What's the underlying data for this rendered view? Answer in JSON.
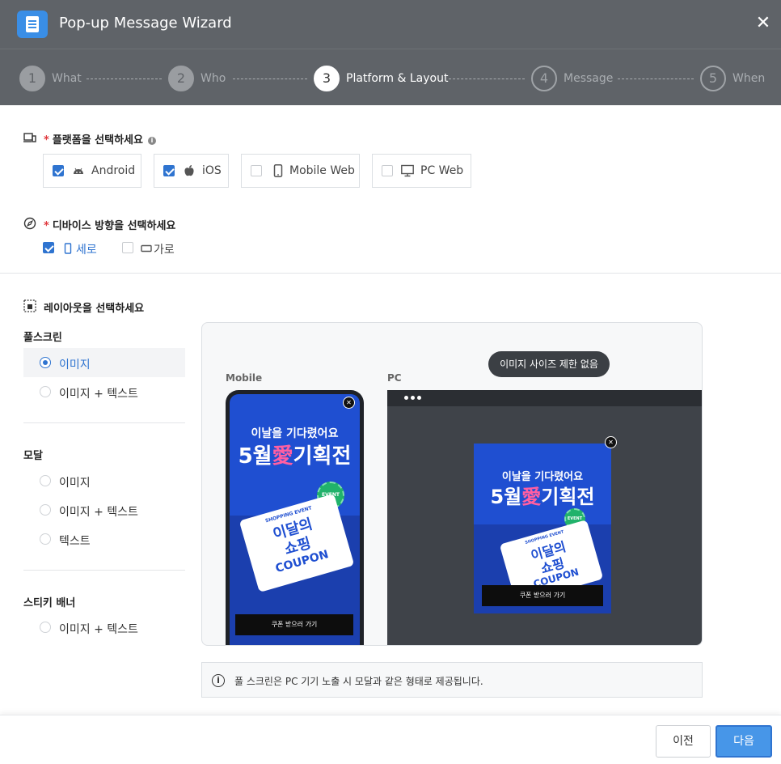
{
  "window": {
    "title": "Pop-up Message Wizard",
    "close_glyph": "✕"
  },
  "steps": [
    {
      "num": "1",
      "label": "What",
      "state": "done"
    },
    {
      "num": "2",
      "label": "Who",
      "state": "done"
    },
    {
      "num": "3",
      "label": "Platform & Layout",
      "state": "active"
    },
    {
      "num": "4",
      "label": "Message",
      "state": "pending"
    },
    {
      "num": "5",
      "label": "When",
      "state": "pending"
    }
  ],
  "platform": {
    "required_mark": "*",
    "title": "플랫폼을 선택하세요",
    "info_glyph": "i",
    "options": [
      {
        "label": "Android",
        "icon": "android-icon",
        "checked": true
      },
      {
        "label": "iOS",
        "icon": "apple-icon",
        "checked": true
      },
      {
        "label": "Mobile Web",
        "icon": "mobile-icon",
        "checked": false
      },
      {
        "label": "PC Web",
        "icon": "monitor-icon",
        "checked": false
      }
    ]
  },
  "orientation": {
    "required_mark": "*",
    "title": "디바이스 방향을 선택하세요",
    "options": [
      {
        "label": "세로",
        "icon": "portrait-icon",
        "checked": true
      },
      {
        "label": "가로",
        "icon": "landscape-icon",
        "checked": false
      }
    ]
  },
  "layout": {
    "title": "레이아웃을 선택하세요",
    "groups": [
      {
        "name": "풀스크린",
        "options": [
          {
            "label": "이미지",
            "selected": true
          },
          {
            "label": "이미지 + 텍스트",
            "selected": false
          }
        ]
      },
      {
        "name": "모달",
        "options": [
          {
            "label": "이미지",
            "selected": false
          },
          {
            "label": "이미지 + 텍스트",
            "selected": false
          },
          {
            "label": "텍스트",
            "selected": false
          }
        ]
      },
      {
        "name": "스티키 배너",
        "options": [
          {
            "label": "이미지 + 텍스트",
            "selected": false
          }
        ]
      }
    ]
  },
  "preview": {
    "mobile_label": "Mobile",
    "pc_label": "PC",
    "size_pill": "이미지 사이즈 제한 없음",
    "banner": {
      "subtitle": "이날을 기다렸어요",
      "main_a": "5월",
      "main_b": "愛",
      "main_c": "기획전",
      "ticket_small": "SHOPPING EVENT",
      "ticket_title_1": "이달의",
      "ticket_title_2": "쇼핑",
      "coupon": "COUPON",
      "badge": "EVENT",
      "button": "쿠폰 받으러 가기",
      "close_glyph": "✕"
    }
  },
  "notice": {
    "icon_glyph": "i",
    "text": "풀 스크린은 PC 기기 노출 시 모달과 같은 형태로 제공됩니다."
  },
  "footer": {
    "prev": "이전",
    "next": "다음"
  },
  "colors": {
    "header": "#5f6368",
    "accent": "#2f74d0",
    "primary_button": "#4796e8",
    "banner_blue": "#1f4fd1",
    "highlight_pink": "#ff5fa2"
  }
}
